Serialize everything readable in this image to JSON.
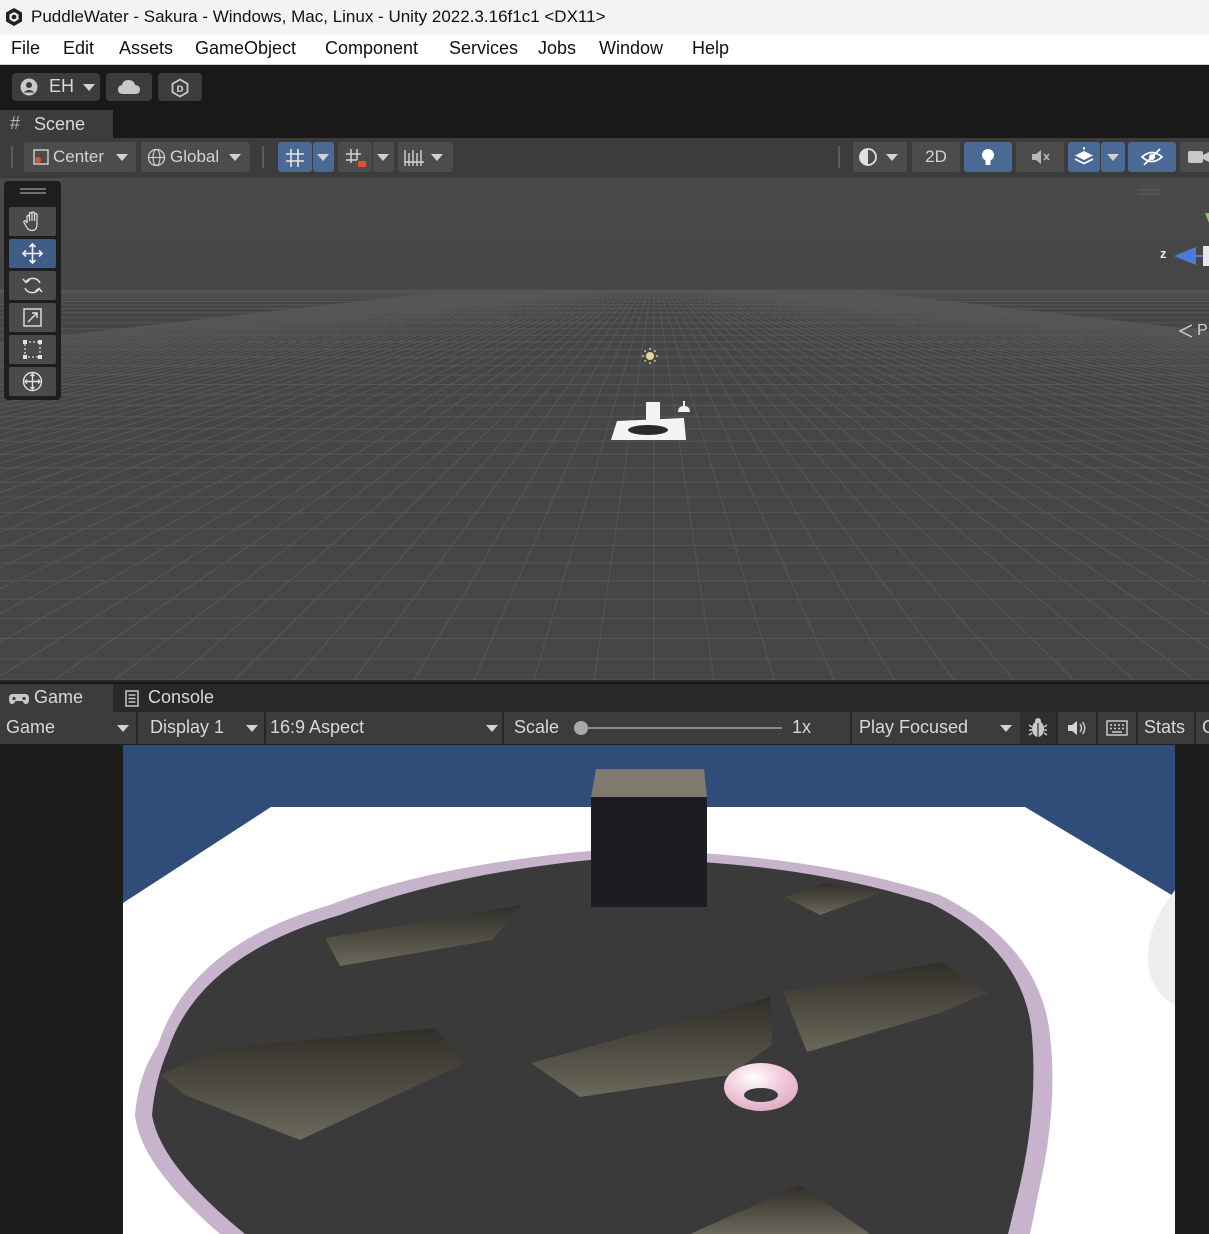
{
  "window": {
    "title": "PuddleWater - Sakura - Windows, Mac, Linux - Unity 2022.3.16f1c1 <DX11>"
  },
  "menu": {
    "items": [
      "File",
      "Edit",
      "Assets",
      "GameObject",
      "Component",
      "Services",
      "Jobs",
      "Window",
      "Help"
    ]
  },
  "toolbar": {
    "account_label": "EH",
    "icons": [
      "account-icon",
      "cloud-icon",
      "plastic-scm-icon"
    ]
  },
  "scene": {
    "tab_label": "Scene",
    "pivot_label": "Center",
    "space_label": "Global",
    "toggle_2d": "2D",
    "gizmo_axis_label": "z",
    "gizmo_mode_label": "P",
    "tools": [
      "hand-tool",
      "move-tool",
      "rotate-tool",
      "scale-tool",
      "rect-tool",
      "transform-tool"
    ],
    "active_tool": "move-tool"
  },
  "game": {
    "tabs": [
      "Game",
      "Console"
    ],
    "mode_label": "Game",
    "display_label": "Display 1",
    "aspect_label": "16:9 Aspect",
    "scale_label": "Scale",
    "scale_value": "1x",
    "play_mode_label": "Play Focused",
    "stats_label": "Stats",
    "gizmos_label_partial": "G"
  },
  "colors": {
    "editor_bg": "#282828",
    "toolbar_bg": "#3c3c3c",
    "active_blue": "#4a6a95",
    "game_sky": "#304d79",
    "puddle_rim": "#c7b4cc",
    "ground_dark": "#3a3a3a"
  }
}
